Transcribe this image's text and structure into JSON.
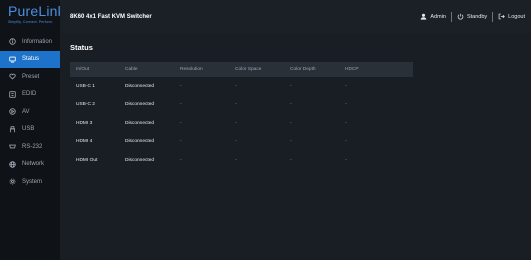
{
  "brand": {
    "name": "PureLink",
    "tagline": "Simplify. Connect. Perform."
  },
  "header": {
    "title": "8K60 4x1 Fast KVM Switcher",
    "user_label": "Admin",
    "standby_label": "Standby",
    "logout_label": "Logout"
  },
  "sidebar": {
    "items": [
      {
        "label": "Information",
        "icon": "info-icon"
      },
      {
        "label": "Status",
        "icon": "monitor-icon",
        "active": true
      },
      {
        "label": "Preset",
        "icon": "heart-icon"
      },
      {
        "label": "EDID",
        "icon": "edid-icon"
      },
      {
        "label": "AV",
        "icon": "play-icon"
      },
      {
        "label": "USB",
        "icon": "usb-icon"
      },
      {
        "label": "RS-232",
        "icon": "serial-icon"
      },
      {
        "label": "Network",
        "icon": "globe-icon"
      },
      {
        "label": "System",
        "icon": "gear-icon"
      }
    ]
  },
  "main": {
    "section_title": "Status",
    "columns": [
      "In/Out",
      "Cable",
      "Resolution",
      "Color Space",
      "Color Depth",
      "HDCP"
    ],
    "rows": [
      [
        "USB-C 1",
        "Disconnected",
        "-",
        "-",
        "-",
        "-"
      ],
      [
        "USB-C 2",
        "Disconnected",
        "-",
        "-",
        "-",
        "-"
      ],
      [
        "HDMI 3",
        "Disconnected",
        "-",
        "-",
        "-",
        "-"
      ],
      [
        "HDMI 4",
        "Disconnected",
        "-",
        "-",
        "-",
        "-"
      ],
      [
        "HDMI Out",
        "Disconnected",
        "-",
        "-",
        "-",
        "-"
      ]
    ]
  },
  "colors": {
    "accent": "#1d73c9",
    "brand": "#4b8fe0",
    "background": "#191e24"
  }
}
